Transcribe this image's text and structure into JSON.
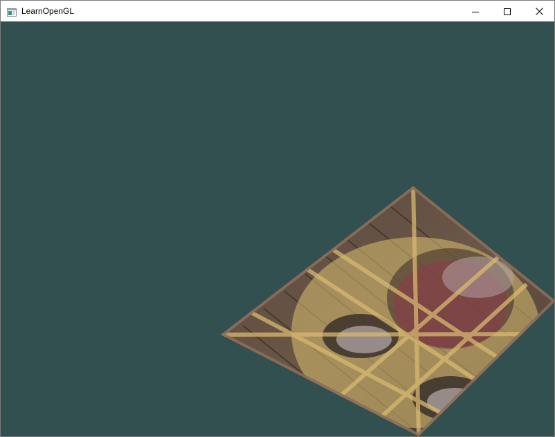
{
  "window": {
    "title": "LearnOpenGL",
    "icon": "app-window-icon",
    "controls": {
      "minimize": "minimize-icon",
      "maximize": "maximize-icon",
      "close": "close-icon"
    }
  },
  "scene": {
    "clear_color": "#335050",
    "object": "textured-quad",
    "textures": [
      "wooden-container",
      "awesome-face"
    ]
  }
}
